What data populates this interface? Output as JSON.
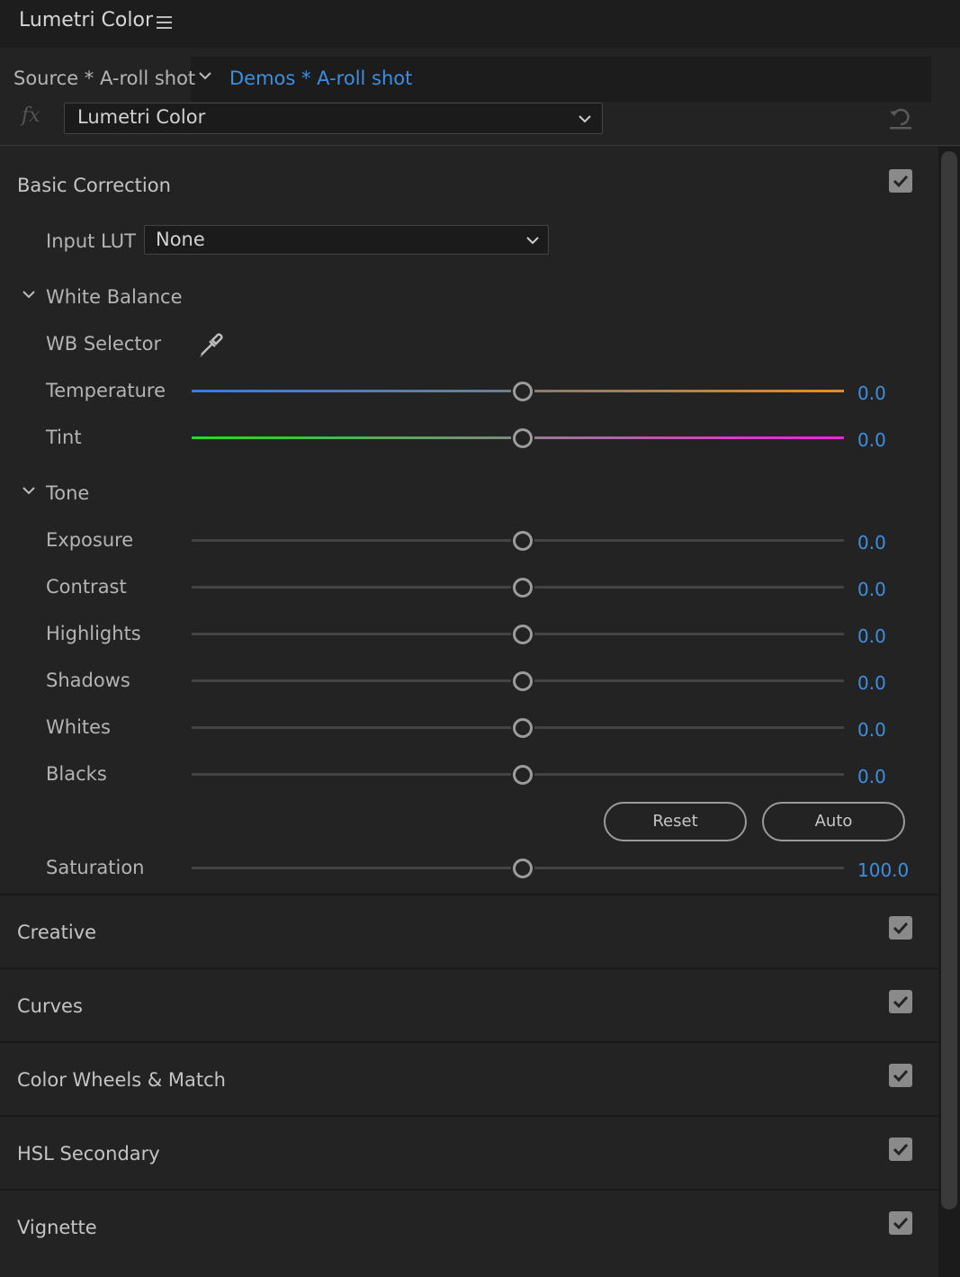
{
  "panel": {
    "title": "Lumetri Color"
  },
  "tabs": {
    "source": "Source * A-roll shot",
    "sequence": "Demos * A-roll shot"
  },
  "effect": {
    "selected": "Lumetri Color"
  },
  "basic_correction": {
    "title": "Basic Correction",
    "enabled": true,
    "input_lut_label": "Input LUT",
    "input_lut_value": "None",
    "white_balance": {
      "title": "White Balance",
      "wb_selector_label": "WB Selector",
      "temperature": {
        "label": "Temperature",
        "value": "0.0"
      },
      "tint": {
        "label": "Tint",
        "value": "0.0"
      }
    },
    "tone": {
      "title": "Tone",
      "exposure": {
        "label": "Exposure",
        "value": "0.0"
      },
      "contrast": {
        "label": "Contrast",
        "value": "0.0"
      },
      "highlights": {
        "label": "Highlights",
        "value": "0.0"
      },
      "shadows": {
        "label": "Shadows",
        "value": "0.0"
      },
      "whites": {
        "label": "Whites",
        "value": "0.0"
      },
      "blacks": {
        "label": "Blacks",
        "value": "0.0"
      },
      "reset_label": "Reset",
      "auto_label": "Auto",
      "saturation": {
        "label": "Saturation",
        "value": "100.0"
      }
    }
  },
  "sections": {
    "creative": "Creative",
    "curves": "Curves",
    "color_wheels": "Color Wheels & Match",
    "hsl_secondary": "HSL Secondary",
    "vignette": "Vignette"
  },
  "colors": {
    "accent_blue": "#3d8fe0",
    "temperature_cool": "#2f7fe8",
    "temperature_warm": "#f08a1c",
    "tint_green": "#22dd22",
    "tint_magenta": "#ee22dd"
  }
}
